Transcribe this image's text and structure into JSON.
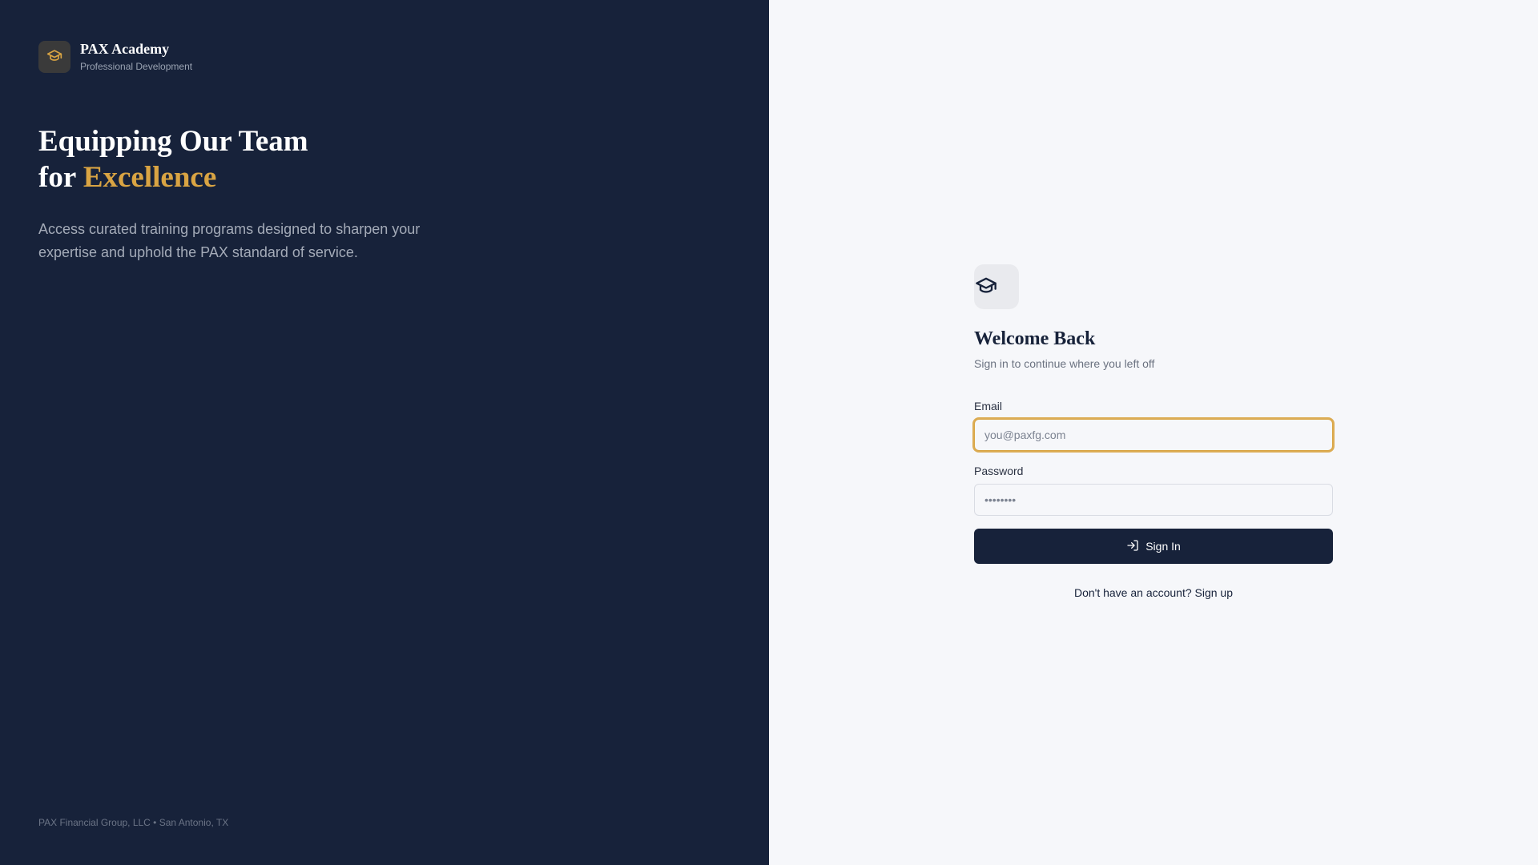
{
  "brand": {
    "name": "PAX Academy",
    "subtitle": "Professional Development",
    "icon": "graduation-cap-icon",
    "accent_color": "#d9a443"
  },
  "hero": {
    "title_line1": "Equipping Our Team",
    "title_line2_prefix": "for ",
    "title_line2_accent": "Excellence",
    "description": "Access curated training programs designed to sharpen your expertise and uphold the PAX standard of service."
  },
  "footer": {
    "text": "PAX Financial Group, LLC • San Antonio, TX"
  },
  "login": {
    "icon": "graduation-cap-icon",
    "title": "Welcome Back",
    "subtitle": "Sign in to continue where you left off",
    "email_label": "Email",
    "email_placeholder": "you@paxfg.com",
    "email_value": "",
    "password_label": "Password",
    "password_placeholder": "••••••••",
    "password_value": "",
    "submit_label": "Sign In",
    "submit_icon": "log-in-icon",
    "signup_prompt": "Don't have an account? Sign up"
  },
  "colors": {
    "dark_panel": "#17223a",
    "light_panel": "#f6f7fa",
    "accent": "#d9a443"
  }
}
